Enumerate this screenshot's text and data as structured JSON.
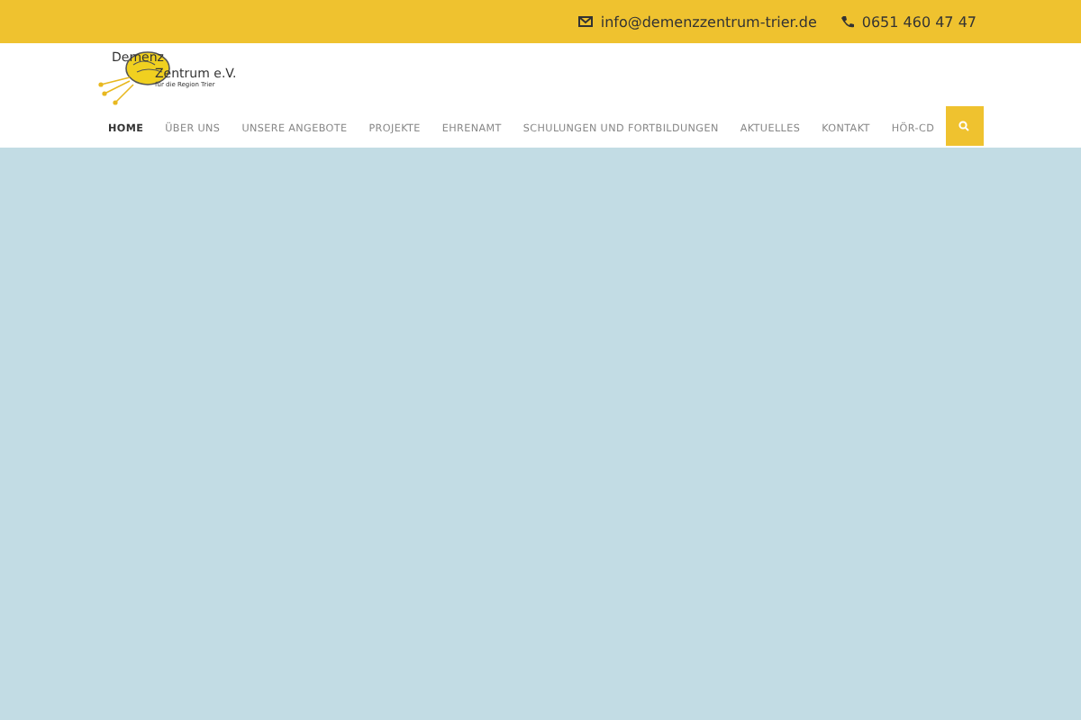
{
  "topbar": {
    "email": "info@demenzzentrum-trier.de",
    "phone": "0651 460 47 47"
  },
  "logo": {
    "line1": "Demenz",
    "line2": "Zentrum e.V.",
    "tagline": "für die Region Trier"
  },
  "nav": [
    {
      "label": "HOME",
      "selected": true
    },
    {
      "label": "ÜBER UNS",
      "selected": false
    },
    {
      "label": "UNSERE ANGEBOTE",
      "selected": false
    },
    {
      "label": "PROJEKTE",
      "selected": false
    },
    {
      "label": "EHRENAMT",
      "selected": false
    },
    {
      "label": "SCHULUNGEN UND FORTBILDUNGEN",
      "selected": false
    },
    {
      "label": "AKTUELLES",
      "selected": false
    },
    {
      "label": "KONTAKT",
      "selected": false
    },
    {
      "label": "HÖR-CD",
      "selected": false
    }
  ]
}
